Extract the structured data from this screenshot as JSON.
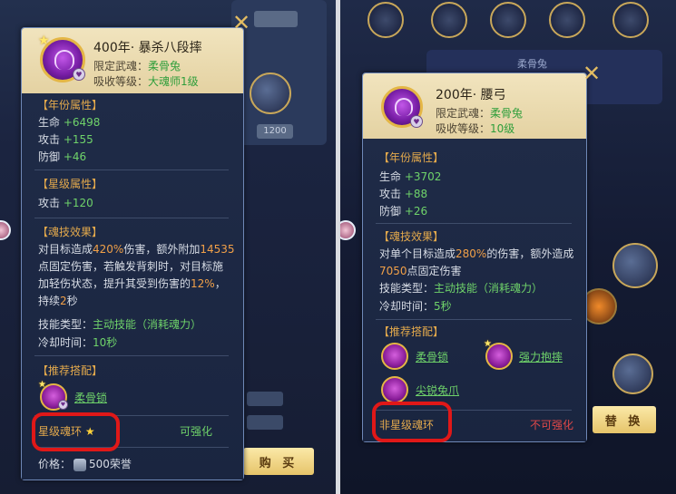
{
  "left_card": {
    "title": "400年·  暴杀八段摔",
    "restrict_label": "限定武魂：",
    "restrict_value": "柔骨兔",
    "absorb_label": "吸收等级：",
    "absorb_value": "大魂师1级",
    "year_attr_title": "【年份属性】",
    "hp_label": "生命",
    "hp_value": "+6498",
    "atk_label": "攻击",
    "atk_value": "+155",
    "def_label": "防御",
    "def_value": "+46",
    "star_attr_title": "【星级属性】",
    "star_atk_label": "攻击",
    "star_atk_value": "+120",
    "effect_title": "【魂技效果】",
    "effect_l1_a": "对目标造成",
    "effect_l1_b": "420%",
    "effect_l1_c": "伤害，额外附加",
    "effect_l1_d": "14535",
    "effect_l2": "点固定伤害，若触发背刺时，对目标施",
    "effect_l3_a": "加轻伤状态，提升其受到伤害的",
    "effect_l3_b": "12%",
    "effect_l3_c": "，",
    "effect_l4_a": "持续",
    "effect_l4_b": "2",
    "effect_l4_c": "秒",
    "type_label": "技能类型：",
    "type_value": "主动技能（消耗魂力）",
    "cd_label": "冷却时间：",
    "cd_value": "10秒",
    "rec_title": "【推荐搭配】",
    "rec_items": [
      "柔骨锁"
    ],
    "star_ring_label": "星级魂环",
    "enhance_label": "可强化",
    "price_label": "价格：",
    "price_value": "500荣誉"
  },
  "right_card": {
    "title": "200年·  腰弓",
    "restrict_label": "限定武魂：",
    "restrict_value": "柔骨兔",
    "absorb_label": "吸收等级：",
    "absorb_value": "10级",
    "year_attr_title": "【年份属性】",
    "hp_label": "生命",
    "hp_value": "+3702",
    "atk_label": "攻击",
    "atk_value": "+88",
    "def_label": "防御",
    "def_value": "+26",
    "effect_title": "【魂技效果】",
    "effect_l1_a": "对单个目标造成",
    "effect_l1_b": "280%",
    "effect_l1_c": "的伤害，额外造成",
    "effect_l2_a": "7050",
    "effect_l2_b": "点固定伤害",
    "type_label": "技能类型：",
    "type_value": "主动技能（消耗魂力）",
    "cd_label": "冷却时间：",
    "cd_value": "5秒",
    "rec_title": "【推荐搭配】",
    "rec_items": [
      "柔骨锁",
      "强力抱摔",
      "尖锐兔爪"
    ],
    "nonstar_ring_label": "非星级魂环",
    "enhance_label": "不可强化"
  },
  "buttons": {
    "buy": "购 买",
    "swap": "替 换",
    "close": "✕"
  },
  "background": {
    "left_small_btn": "1200",
    "right_panel_label": "柔骨兔"
  },
  "icons": {
    "close": "close-icon",
    "star": "star-icon",
    "honor": "honor-currency-icon"
  },
  "colors": {
    "accent_gold": "#e4b645",
    "value_green": "#6fd36a",
    "section_orange": "#e3a94c",
    "warning_red": "#e04848",
    "highlight_box": "#e01818"
  }
}
